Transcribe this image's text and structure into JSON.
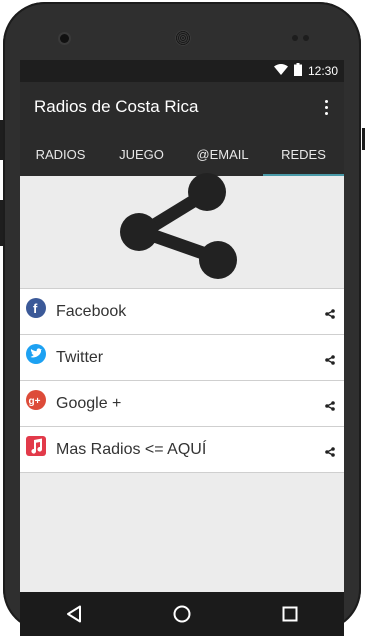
{
  "status_bar": {
    "time": "12:30",
    "icons": [
      "wifi-icon",
      "battery-icon"
    ]
  },
  "app_bar": {
    "title": "Radios de Costa Rica",
    "menu_icon": "overflow-menu-icon"
  },
  "tabs": [
    {
      "label": "RADIOS",
      "active": false
    },
    {
      "label": "JUEGO",
      "active": false
    },
    {
      "label": "@EMAIL",
      "active": false
    },
    {
      "label": "REDES",
      "active": true
    }
  ],
  "hero": {
    "icon": "share-icon"
  },
  "list": [
    {
      "label": "Facebook",
      "icon": "facebook-icon",
      "color": "#3b5998"
    },
    {
      "label": "Twitter",
      "icon": "twitter-icon",
      "color": "#1da1f2"
    },
    {
      "label": "Google +",
      "icon": "google-plus-icon",
      "color": "#dd4b39"
    },
    {
      "label": "Mas Radios <= AQUÍ",
      "icon": "music-note-icon",
      "color": "#e23a4a"
    }
  ],
  "colors": {
    "tab_indicator": "#4a9aa8",
    "app_bar": "#2b2b2b"
  },
  "nav_bar": {
    "icons": [
      "back-icon",
      "home-icon",
      "recents-icon"
    ]
  }
}
